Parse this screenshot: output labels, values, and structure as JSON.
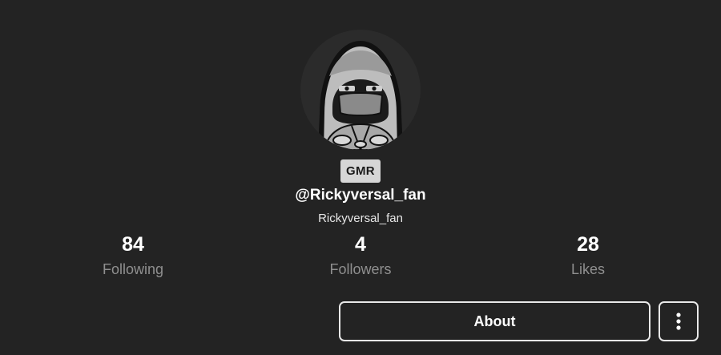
{
  "profile": {
    "avatar_icon": "hooded-character-avatar",
    "badge": "GMR",
    "handle": "@Rickyversal_fan",
    "nickname": "Rickyversal_fan"
  },
  "stats": [
    {
      "value": "84",
      "label": "Following"
    },
    {
      "value": "4",
      "label": "Followers"
    },
    {
      "value": "28",
      "label": "Likes"
    }
  ],
  "actions": {
    "about_label": "About",
    "more_icon": "more-vertical-icon"
  },
  "colors": {
    "background": "#232323",
    "badge_bg": "#d6d6d6",
    "label_gray": "#8f8f8f",
    "button_border": "#e8e8e8"
  }
}
